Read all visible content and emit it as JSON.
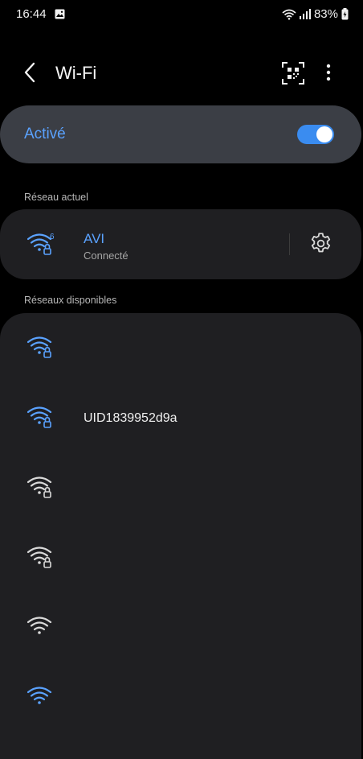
{
  "status_bar": {
    "time": "16:44",
    "battery": "83%"
  },
  "header": {
    "title": "Wi-Fi"
  },
  "toggle": {
    "label": "Activé",
    "on": true
  },
  "current_section": {
    "label": "Réseau actuel"
  },
  "current_network": {
    "name": "AVI",
    "status": "Connecté",
    "badge": "6"
  },
  "available_section": {
    "label": "Réseaux disponibles"
  },
  "networks": [
    {
      "name": "",
      "secured": true,
      "icon_color": "#5aa2ff"
    },
    {
      "name": "UID1839952d9a",
      "secured": true,
      "icon_color": "#5aa2ff"
    },
    {
      "name": "",
      "secured": true,
      "icon_color": "#d9d9d9"
    },
    {
      "name": "",
      "secured": true,
      "icon_color": "#d9d9d9"
    },
    {
      "name": "",
      "secured": false,
      "icon_color": "#d9d9d9"
    },
    {
      "name": "",
      "secured": false,
      "icon_color": "#5aa2ff"
    }
  ],
  "colors": {
    "accent": "#5aa2ff",
    "card": "#1f1f22",
    "toggle_card": "#3b3e45"
  }
}
